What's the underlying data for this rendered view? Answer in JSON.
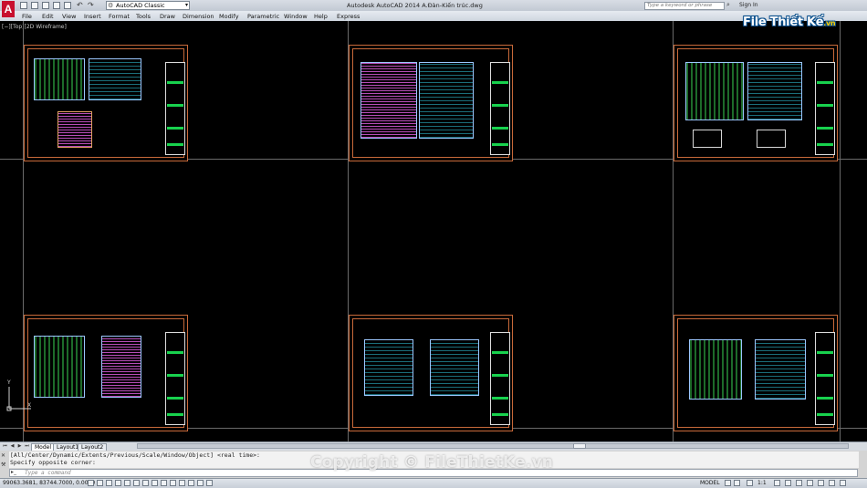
{
  "app": {
    "logo_letter": "A",
    "title": "Autodesk AutoCAD 2014    A.Đàn-Kiến trúc.dwg",
    "workspace": "AutoCAD Classic",
    "search_placeholder": "Type a keyword or phrase",
    "sign_in": "Sign In"
  },
  "brand": {
    "text": "File Thiết Kế",
    "suffix": ".vn"
  },
  "menu": [
    "File",
    "Edit",
    "View",
    "Insert",
    "Format",
    "Tools",
    "Draw",
    "Dimension",
    "Modify",
    "Parametric",
    "Window",
    "Help",
    "Express"
  ],
  "viewport_label": "[−][Top][2D Wireframe]",
  "ucs": {
    "x": "X",
    "y": "Y"
  },
  "tabs": [
    "Model",
    "Layout1",
    "Layout2"
  ],
  "command": {
    "history_line1": "[All/Center/Dynamic/Extents/Previous/Scale/Window/Object] <real time>:",
    "history_line2": "Specify opposite corner:",
    "input_placeholder": "Type a command"
  },
  "watermark": "Copyright © FileThietKe.vn",
  "status": {
    "coordinates": "99063.3681, 83744.7000, 0.0000",
    "model": "MODEL",
    "scale": "1:1"
  },
  "colors": {
    "canvas": "#000000",
    "sheet_border": "#c96a3a",
    "titleblock_green": "#18d24e",
    "autocad_red": "#c8102e",
    "brand_blue": "#0a4f8c"
  }
}
